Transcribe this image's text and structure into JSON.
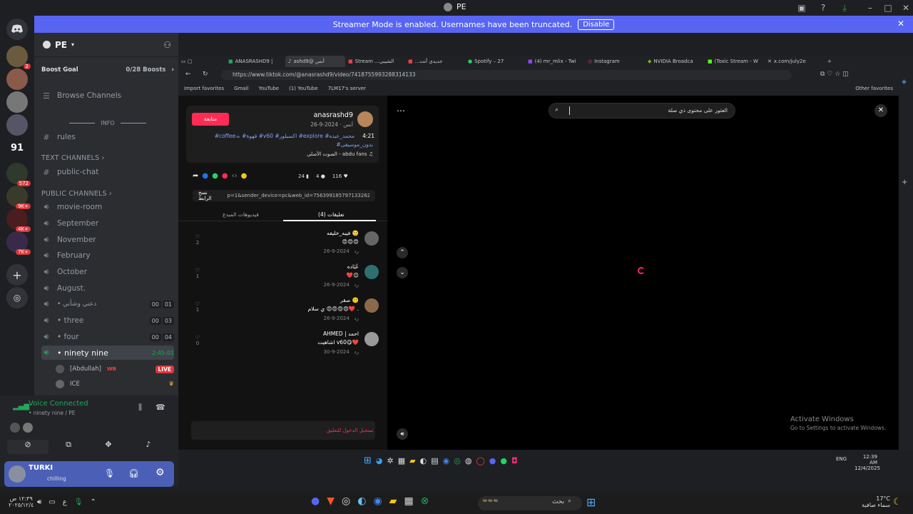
{
  "app": {
    "title": "PE"
  },
  "banner": {
    "text": "Streamer Mode is enabled. Usernames have been truncated.",
    "button": "Disable"
  },
  "servers": {
    "badges": [
      "2",
      "572",
      "9K+",
      "4K+",
      "7K+"
    ],
    "numbered": "91"
  },
  "guild": {
    "name": "PE",
    "boost_goal": "Boost Goal",
    "boost_count": "0/28 Boosts",
    "browse": "Browse Channels",
    "info_category": "INFO",
    "rules": "rules",
    "text_category": "TEXT CHANNELS",
    "text_channels": [
      "public-chat"
    ],
    "public_category": "PUBLIC CHANNELS",
    "voice_channels": [
      "movie-room",
      "September",
      "November",
      "February",
      "October",
      "August."
    ],
    "numbered_channels": [
      {
        "name": "• دعني وشأني",
        "a": "00",
        "b": "01"
      },
      {
        "name": "• three",
        "a": "00",
        "b": "03"
      },
      {
        "name": "• four",
        "a": "00",
        "b": "04"
      }
    ],
    "active_channel": "• ninety nine",
    "active_time": "2:45:01",
    "members": [
      {
        "name": "[Abdullah]",
        "tag": "WB",
        "live": "LIVE"
      },
      {
        "name": "ICE"
      }
    ]
  },
  "voice": {
    "status": "Voice Connected",
    "location": "• ninety nine / PE"
  },
  "user": {
    "name": "TURKI",
    "status": "chilling"
  },
  "browser": {
    "tabs": [
      "ANASRASHD9 |",
      "ashd9@ أنس",
      "Stream ...الشيبي",
      "...جديدي أنت",
      "Spotify – 27",
      "(4) mr_mlix - Twi",
      "Instagram",
      "NVIDIA Broadca",
      "(Toxic Stream - W",
      "x.com/july2e"
    ],
    "url": "https://www.tiktok.com/@anasrashd9/video/7418755993288314133",
    "favorites": [
      "Import favorites",
      "Gmail",
      "YouTube",
      "(1) YouTube",
      "7LM17's server"
    ],
    "other_favorites": "Other favorites"
  },
  "tiktok": {
    "follow": "متابعة",
    "username": "anasrashd9",
    "subtitle": "أنس · 2024-9-26",
    "caption": "#coffee☕ #قهوة #v60 #اكسبلور #explore #محمد_عبده",
    "caption2": "#بدون_موسيقى",
    "music": "الصوت الأصلي - abdu fans",
    "time_label": "4:21",
    "counts": {
      "likes": "116",
      "comments": "4",
      "saves": "24"
    },
    "copy_link": "نسخ الرابط",
    "link_text": "p=1&sender_device=pc&web_id=7563991857971332626",
    "tab_comments": "تعليقات (4)",
    "tab_creator": "فيديوهات المبدع",
    "search_placeholder": "العثور على محتوى ذي صلة",
    "login_prompt": "تسجيل الدخول للتعليق",
    "comments": [
      {
        "user": "فيبه_خليفه 🙂",
        "text": "😍😍😍",
        "date": "2024-9-26",
        "reply": "رد",
        "likes": "2"
      },
      {
        "user": "عُبَاده",
        "text": "❤️😊",
        "date": "2024-9-26",
        "reply": "رد",
        "likes": "1"
      },
      {
        "user": "صقر 🙂",
        "text": "ي سلام 😍😍😍😍❤️ .",
        "date": "2024-9-26",
        "reply": "رد",
        "likes": "1"
      },
      {
        "user": "AHMED | احمد",
        "text": "اشاهيت v60😋❤️",
        "date": "2024-9-30",
        "reply": "رد",
        "likes": "0"
      }
    ]
  },
  "watermark": {
    "line1": "Activate Windows",
    "line2": "Go to Settings to activate Windows."
  },
  "inner_clock": {
    "time": "12:39 AM",
    "date": "12/4/2025",
    "lang": "ENG"
  },
  "taskbar": {
    "search_placeholder": "بحث",
    "clock": "١٢:٣٩ ص",
    "date": "٢٠٢٥/١٢/٤",
    "weather_temp": "17°C",
    "weather_text": "سماء صافية",
    "lang": "ع"
  },
  "colors": {
    "discord_blurple": "#5865f2",
    "tiktok_red": "#fe2c55",
    "live_red": "#da373c",
    "voice_green": "#23a55a"
  }
}
